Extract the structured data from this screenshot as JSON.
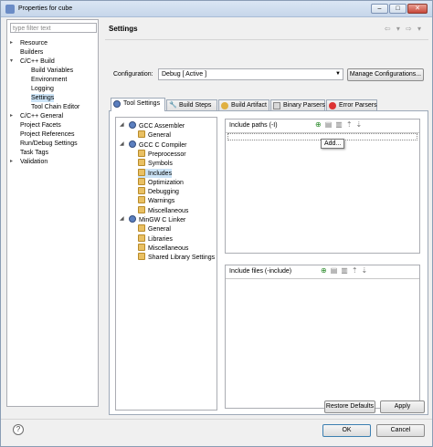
{
  "window": {
    "title": "Properties for cube"
  },
  "filter": {
    "placeholder": "type filter text"
  },
  "nav_tree": [
    {
      "label": "Resource",
      "expander": "▸"
    },
    {
      "label": "Builders",
      "expander": ""
    },
    {
      "label": "C/C++ Build",
      "expander": "▾"
    },
    {
      "label": "Build Variables",
      "expander": ""
    },
    {
      "label": "Environment",
      "expander": ""
    },
    {
      "label": "Logging",
      "expander": ""
    },
    {
      "label": "Settings",
      "expander": ""
    },
    {
      "label": "Tool Chain Editor",
      "expander": ""
    },
    {
      "label": "C/C++ General",
      "expander": "▸"
    },
    {
      "label": "Project Facets",
      "expander": ""
    },
    {
      "label": "Project References",
      "expander": ""
    },
    {
      "label": "Run/Debug Settings",
      "expander": ""
    },
    {
      "label": "Task Tags",
      "expander": ""
    },
    {
      "label": "Validation",
      "expander": "▸"
    }
  ],
  "page": {
    "title": "Settings",
    "nav_icons": "⇦ ▾ ⇨ ▾"
  },
  "configuration": {
    "label": "Configuration:",
    "value": "Debug  [ Active ]",
    "manage_button": "Manage Configurations..."
  },
  "tabs": [
    "Tool Settings",
    "Build Steps",
    "Build Artifact",
    "Binary Parsers",
    "Error Parsers"
  ],
  "tool_tree": [
    {
      "label": "GCC Assembler",
      "kind": "tool"
    },
    {
      "label": "General",
      "kind": "option"
    },
    {
      "label": "GCC C Compiler",
      "kind": "tool"
    },
    {
      "label": "Preprocessor",
      "kind": "option"
    },
    {
      "label": "Symbols",
      "kind": "option"
    },
    {
      "label": "Includes",
      "kind": "option"
    },
    {
      "label": "Optimization",
      "kind": "option"
    },
    {
      "label": "Debugging",
      "kind": "option"
    },
    {
      "label": "Warnings",
      "kind": "option"
    },
    {
      "label": "Miscellaneous",
      "kind": "option"
    },
    {
      "label": "MinGW C Linker",
      "kind": "tool"
    },
    {
      "label": "General",
      "kind": "option"
    },
    {
      "label": "Libraries",
      "kind": "option"
    },
    {
      "label": "Miscellaneous",
      "kind": "option"
    },
    {
      "label": "Shared Library Settings",
      "kind": "option"
    }
  ],
  "include_paths": {
    "title": "Include paths (-I)",
    "tooltip": "Add..."
  },
  "include_files": {
    "title": "Include files (-include)"
  },
  "buttons": {
    "restore": "Restore Defaults",
    "apply": "Apply",
    "ok": "OK",
    "cancel": "Cancel",
    "help": "?"
  },
  "window_buttons": {
    "minimize": "–",
    "maximize": "□",
    "close": "✕"
  },
  "colors": {
    "selection": "#cce4f7",
    "add_icon": "#2a8a2a"
  }
}
